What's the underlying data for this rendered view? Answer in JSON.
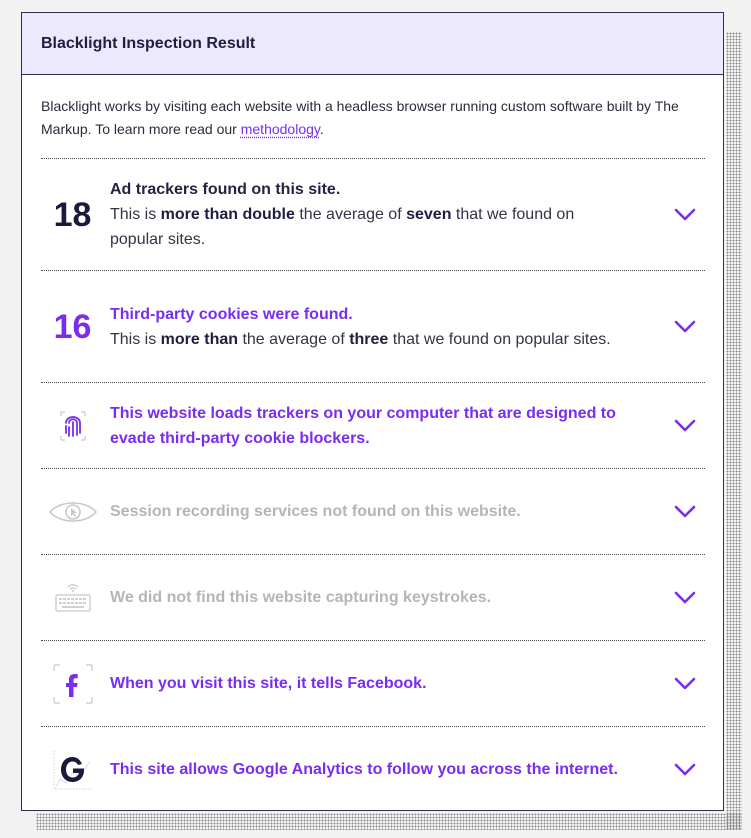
{
  "card": {
    "title": "Blacklight Inspection Result",
    "intro_text": "Blacklight works by visiting each website with a headless browser running custom software built by The Markup. To learn more read our ",
    "intro_link": "methodology",
    "intro_end": "."
  },
  "rows": [
    {
      "number": "18",
      "headline": "Ad trackers found on this site.",
      "body_a": "This is ",
      "body_b": "more than double",
      "body_c": " the average of ",
      "body_d": "seven",
      "body_e": " that we found on popular sites."
    },
    {
      "number": "16",
      "headline": "Third-party cookies were found.",
      "body_a": "This is ",
      "body_b": "more than",
      "body_c": " the average of ",
      "body_d": "three",
      "body_e": " that we found on popular sites."
    },
    {
      "icon": "fingerprint-icon",
      "headline": "This website loads trackers on your computer that are designed to evade third-party cookie blockers."
    },
    {
      "icon": "eye-icon",
      "headline": "Session recording services not found on this website."
    },
    {
      "icon": "keyboard-icon",
      "headline": "We did not find this website capturing keystrokes."
    },
    {
      "icon": "facebook-icon",
      "headline": "When you visit this site, it tells Facebook."
    },
    {
      "icon": "google-icon",
      "headline": "This site allows Google Analytics to follow you across the internet."
    }
  ],
  "colors": {
    "accent": "#7a2cf0",
    "header_bg": "#ece8fe",
    "muted": "#b5b5b5",
    "dark": "#1a1a3c"
  }
}
